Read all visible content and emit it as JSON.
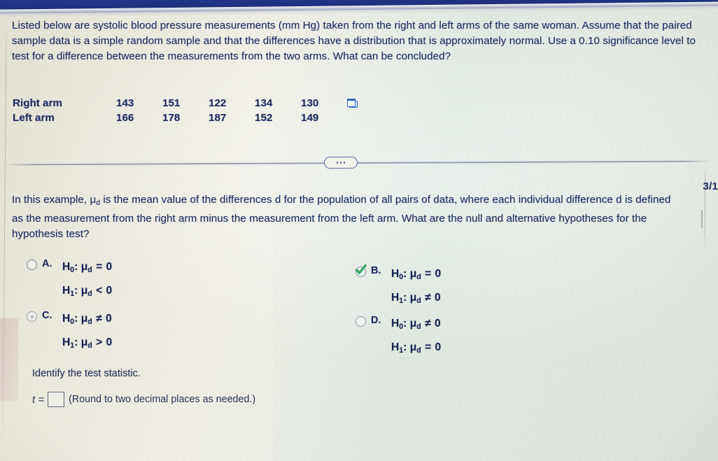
{
  "app": {
    "topbar_color": "#1d3177",
    "background_color": "#eceadf",
    "text_color": "#1e2b5e"
  },
  "problem": {
    "prompt": "Listed below are systolic blood pressure measurements (mm Hg) taken from the right and left arms of the same woman. Assume that the paired sample data is a simple random sample and that the differences have a distribution that is approximately normal. Use a 0.10 significance level to test for a difference between the measurements from the two arms. What can be concluded?",
    "data_table": {
      "rows": [
        {
          "label": "Right arm",
          "values": [
            "143",
            "151",
            "122",
            "134",
            "130"
          ]
        },
        {
          "label": "Left arm",
          "values": [
            "166",
            "178",
            "187",
            "152",
            "149"
          ]
        }
      ],
      "popout_icon": "popout-window-icon"
    },
    "more_button": "...",
    "paragraph2_part1": "In this example, ",
    "paragraph2_mu": "μ",
    "paragraph2_mu_sub": "d",
    "paragraph2_part2": " is the mean value of the differences d for the population of all pairs of data, where each individual difference d is defined as the measurement from the right arm minus the measurement from the left arm. What are the null and alternative hypotheses for the hypothesis test?",
    "page_fragment": "3/1"
  },
  "choices": [
    {
      "letter": "A.",
      "selected": false,
      "correct": false,
      "null_h": {
        "h": "H",
        "h_sub": "0",
        "colon": ":",
        "mu": "μ",
        "mu_sub": "d",
        "op": "=",
        "value": "0"
      },
      "alt_h": {
        "h": "H",
        "h_sub": "1",
        "colon": ":",
        "mu": "μ",
        "mu_sub": "d",
        "op": "<",
        "value": "0"
      }
    },
    {
      "letter": "B.",
      "selected": true,
      "correct": true,
      "null_h": {
        "h": "H",
        "h_sub": "0",
        "colon": ":",
        "mu": "μ",
        "mu_sub": "d",
        "op": "=",
        "value": "0"
      },
      "alt_h": {
        "h": "H",
        "h_sub": "1",
        "colon": ":",
        "mu": "μ",
        "mu_sub": "d",
        "op": "≠",
        "value": "0"
      }
    },
    {
      "letter": "C.",
      "selected": false,
      "correct": false,
      "null_h": {
        "h": "H",
        "h_sub": "0",
        "colon": ":",
        "mu": "μ",
        "mu_sub": "d",
        "op": "≠",
        "value": "0"
      },
      "alt_h": {
        "h": "H",
        "h_sub": "1",
        "colon": ":",
        "mu": "μ",
        "mu_sub": "d",
        "op": ">",
        "value": "0"
      }
    },
    {
      "letter": "D.",
      "selected": false,
      "correct": false,
      "null_h": {
        "h": "H",
        "h_sub": "0",
        "colon": ":",
        "mu": "μ",
        "mu_sub": "d",
        "op": "≠",
        "value": "0"
      },
      "alt_h": {
        "h": "H",
        "h_sub": "1",
        "colon": ":",
        "mu": "μ",
        "mu_sub": "d",
        "op": "=",
        "value": "0"
      }
    }
  ],
  "test_statistic": {
    "instruction": "Identify the test statistic.",
    "label": "t =",
    "value": "",
    "hint": "(Round to two decimal places as needed.)"
  }
}
